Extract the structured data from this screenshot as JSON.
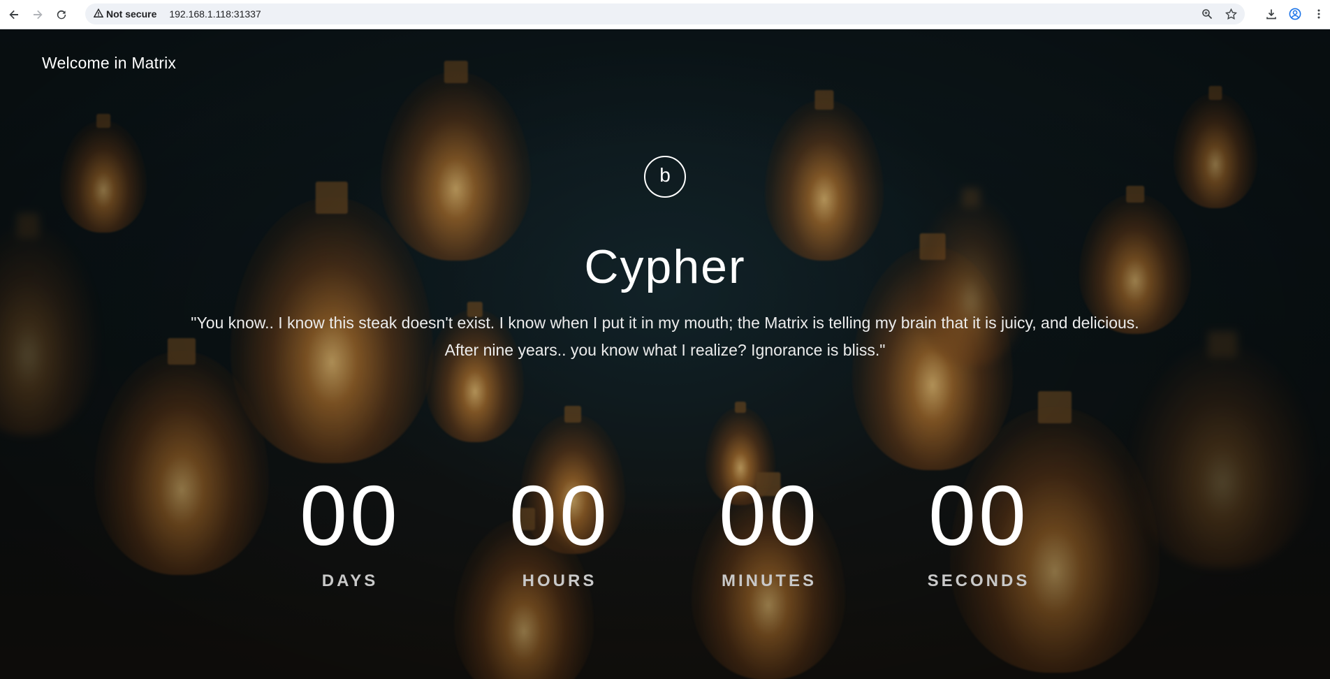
{
  "browser": {
    "security_label": "Not secure",
    "url": "192.168.1.118:31337",
    "icons": [
      "back-icon",
      "forward-icon",
      "reload-icon",
      "warning-icon",
      "zoom-icon",
      "star-icon",
      "download-icon",
      "profile-icon",
      "menu-icon"
    ]
  },
  "page": {
    "welcome": "Welcome in Matrix",
    "logo_letter": "b",
    "title": "Cypher",
    "quote_line1": "\"You know.. I know this steak doesn't exist. I know when I put it in my mouth; the Matrix is telling my brain that it is juicy, and delicious.",
    "quote_line2": "After nine years.. you know what I realize? Ignorance is bliss.\""
  },
  "countdown": [
    {
      "value": "00",
      "label": "DAYS"
    },
    {
      "value": "00",
      "label": "HOURS"
    },
    {
      "value": "00",
      "label": "MINUTES"
    },
    {
      "value": "00",
      "label": "SECONDS"
    }
  ],
  "colors": {
    "text": "#ffffff",
    "label": "#c9c9c9",
    "bulb_glow": "#e08c32"
  }
}
